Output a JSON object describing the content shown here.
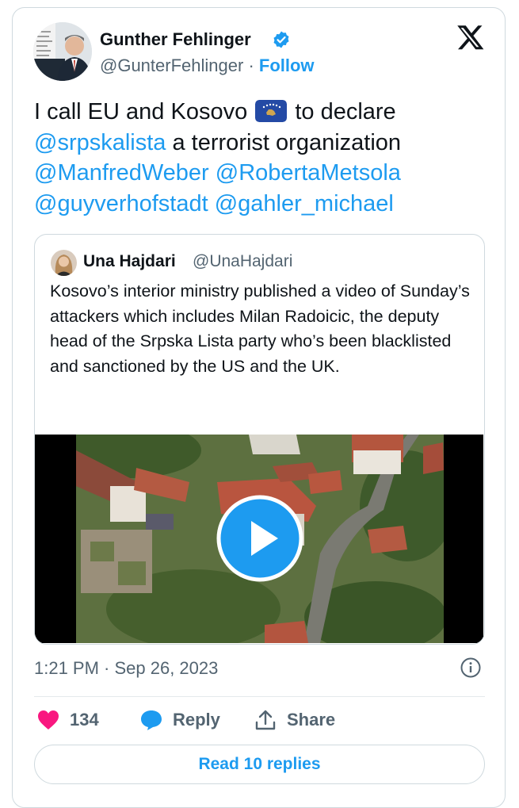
{
  "author": {
    "name": "Gunther Fehlinger",
    "handle": "@GunterFehlinger",
    "separator": "·",
    "follow_label": "Follow"
  },
  "tweet": {
    "line1_before_flag": "I call EU and Kosovo",
    "line1_after_flag": "to declare",
    "mention_srpskalista": "@srpskalista",
    "line2_rest": "a terrorist organization",
    "mention_manfredweber": "@ManfredWeber",
    "mention_robertametsola": "@RobertaMetsola",
    "mention_guyverhofstadt": "@guyverhofstadt",
    "mention_gahler": "@gahler_michael"
  },
  "quoted_tweet": {
    "name": "Una Hajdari",
    "handle": "@UnaHajdari",
    "text": "Kosovo’s interior ministry published a video of Sunday’s attackers which includes Milan Radoicic, the deputy head of the Srpska Lista party who’s been blacklisted and sanctioned by the US and the UK."
  },
  "meta": {
    "timestamp": "1:21 PM · Sep 26, 2023"
  },
  "actions": {
    "like_count": "134",
    "reply_label": "Reply",
    "share_label": "Share"
  },
  "read_replies_label": "Read 10 replies",
  "colors": {
    "accent": "#1d9bf0",
    "like": "#f91880",
    "muted": "#536471",
    "border": "#cfd9de"
  },
  "icons": [
    "verified-badge-icon",
    "x-logo-icon",
    "kosovo-flag-icon",
    "play-icon",
    "info-icon",
    "heart-icon",
    "reply-bubble-icon",
    "share-icon"
  ]
}
